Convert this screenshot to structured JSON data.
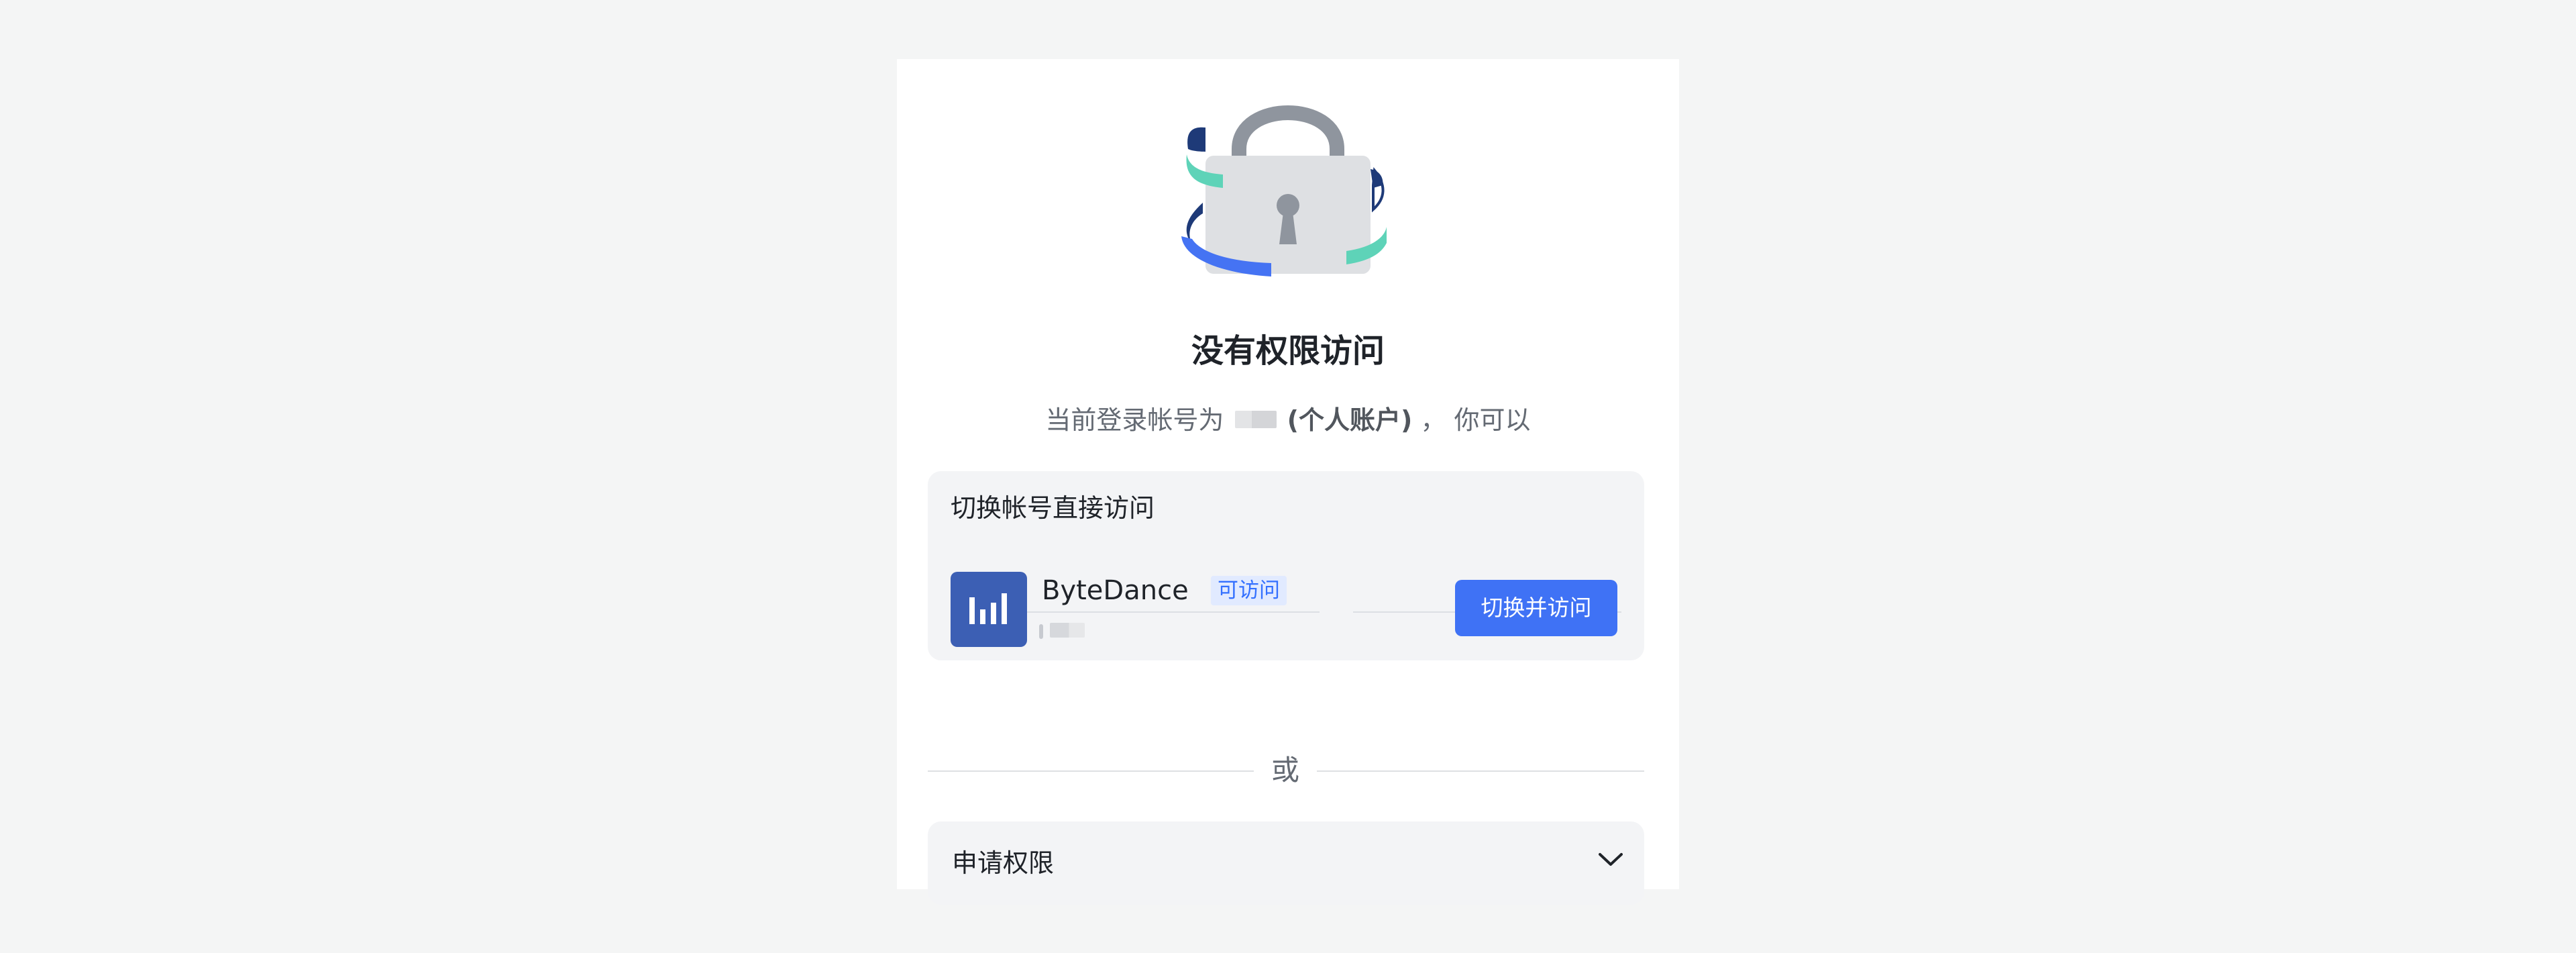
{
  "page": {
    "title": "没有权限访问",
    "subtitle_prefix": "当前登录帐号为",
    "subtitle_account_type": "(个人账户)",
    "subtitle_suffix": "， 你可以"
  },
  "switch_section": {
    "title": "切换帐号直接访问",
    "org": {
      "name": "ByteDance",
      "badge": "可访问"
    },
    "button_label": "切换并访问"
  },
  "divider_text": "或",
  "apply_section": {
    "label": "申请权限"
  },
  "colors": {
    "primary": "#3f72f5",
    "org_logo_bg": "#3c5fb4",
    "badge_bg": "#e1eaff",
    "badge_text": "#3370ff"
  },
  "icons": {
    "illustration": "lock-illustration",
    "org_logo": "bytedance-logo",
    "expand": "chevron-down-icon"
  }
}
